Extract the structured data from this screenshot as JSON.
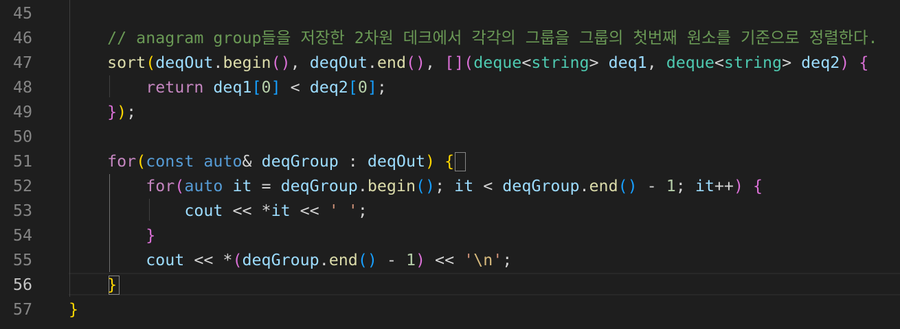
{
  "editor": {
    "current_line": "56",
    "lines": [
      {
        "number": "45",
        "tokens": []
      },
      {
        "number": "46",
        "tokens": [
          {
            "t": "    // anagram group들을 저장한 2차원 데크에서 각각의 그룹을 그룹의 첫번째 원소를 기준으로 정렬한다.",
            "c": "cm"
          }
        ]
      },
      {
        "number": "47",
        "tokens": [
          {
            "t": "    ",
            "c": "pn"
          },
          {
            "t": "sort",
            "c": "fn"
          },
          {
            "t": "(",
            "c": "br1"
          },
          {
            "t": "deqOut",
            "c": "var"
          },
          {
            "t": ".",
            "c": "pn"
          },
          {
            "t": "begin",
            "c": "fn"
          },
          {
            "t": "()",
            "c": "br2"
          },
          {
            "t": ", ",
            "c": "pn"
          },
          {
            "t": "deqOut",
            "c": "var"
          },
          {
            "t": ".",
            "c": "pn"
          },
          {
            "t": "end",
            "c": "fn"
          },
          {
            "t": "()",
            "c": "br2"
          },
          {
            "t": ", ",
            "c": "pn"
          },
          {
            "t": "[]",
            "c": "br2"
          },
          {
            "t": "(",
            "c": "br2"
          },
          {
            "t": "deque",
            "c": "ty"
          },
          {
            "t": "<",
            "c": "pn"
          },
          {
            "t": "string",
            "c": "ty"
          },
          {
            "t": "> ",
            "c": "pn"
          },
          {
            "t": "deq1",
            "c": "var"
          },
          {
            "t": ", ",
            "c": "pn"
          },
          {
            "t": "deque",
            "c": "ty"
          },
          {
            "t": "<",
            "c": "pn"
          },
          {
            "t": "string",
            "c": "ty"
          },
          {
            "t": "> ",
            "c": "pn"
          },
          {
            "t": "deq2",
            "c": "var"
          },
          {
            "t": ")",
            "c": "br2"
          },
          {
            "t": " ",
            "c": "pn"
          },
          {
            "t": "{",
            "c": "br2"
          }
        ]
      },
      {
        "number": "48",
        "tokens": [
          {
            "t": "        ",
            "c": "pn"
          },
          {
            "t": "return",
            "c": "ctl"
          },
          {
            "t": " ",
            "c": "pn"
          },
          {
            "t": "deq1",
            "c": "var"
          },
          {
            "t": "[",
            "c": "br3"
          },
          {
            "t": "0",
            "c": "num"
          },
          {
            "t": "]",
            "c": "br3"
          },
          {
            "t": " < ",
            "c": "pn"
          },
          {
            "t": "deq2",
            "c": "var"
          },
          {
            "t": "[",
            "c": "br3"
          },
          {
            "t": "0",
            "c": "num"
          },
          {
            "t": "]",
            "c": "br3"
          },
          {
            "t": ";",
            "c": "pn"
          }
        ]
      },
      {
        "number": "49",
        "tokens": [
          {
            "t": "    ",
            "c": "pn"
          },
          {
            "t": "}",
            "c": "br2"
          },
          {
            "t": ")",
            "c": "br1"
          },
          {
            "t": ";",
            "c": "pn"
          }
        ]
      },
      {
        "number": "50",
        "tokens": []
      },
      {
        "number": "51",
        "tokens": [
          {
            "t": "    ",
            "c": "pn"
          },
          {
            "t": "for",
            "c": "ctl"
          },
          {
            "t": "(",
            "c": "br1"
          },
          {
            "t": "const",
            "c": "kw"
          },
          {
            "t": " ",
            "c": "pn"
          },
          {
            "t": "auto",
            "c": "kw"
          },
          {
            "t": "& ",
            "c": "pn"
          },
          {
            "t": "deqGroup",
            "c": "var"
          },
          {
            "t": " : ",
            "c": "pn"
          },
          {
            "t": "deqOut",
            "c": "var"
          },
          {
            "t": ")",
            "c": "br1"
          },
          {
            "t": " ",
            "c": "pn"
          },
          {
            "t": "{",
            "c": "br1"
          }
        ]
      },
      {
        "number": "52",
        "tokens": [
          {
            "t": "        ",
            "c": "pn"
          },
          {
            "t": "for",
            "c": "ctl"
          },
          {
            "t": "(",
            "c": "br2"
          },
          {
            "t": "auto",
            "c": "kw"
          },
          {
            "t": " ",
            "c": "pn"
          },
          {
            "t": "it",
            "c": "var"
          },
          {
            "t": " = ",
            "c": "pn"
          },
          {
            "t": "deqGroup",
            "c": "var"
          },
          {
            "t": ".",
            "c": "pn"
          },
          {
            "t": "begin",
            "c": "fn"
          },
          {
            "t": "()",
            "c": "br3"
          },
          {
            "t": "; ",
            "c": "pn"
          },
          {
            "t": "it",
            "c": "var"
          },
          {
            "t": " < ",
            "c": "pn"
          },
          {
            "t": "deqGroup",
            "c": "var"
          },
          {
            "t": ".",
            "c": "pn"
          },
          {
            "t": "end",
            "c": "fn"
          },
          {
            "t": "()",
            "c": "br3"
          },
          {
            "t": " - ",
            "c": "pn"
          },
          {
            "t": "1",
            "c": "num"
          },
          {
            "t": "; ",
            "c": "pn"
          },
          {
            "t": "it",
            "c": "var"
          },
          {
            "t": "++",
            "c": "pn"
          },
          {
            "t": ")",
            "c": "br2"
          },
          {
            "t": " ",
            "c": "pn"
          },
          {
            "t": "{",
            "c": "br2"
          }
        ]
      },
      {
        "number": "53",
        "tokens": [
          {
            "t": "            ",
            "c": "pn"
          },
          {
            "t": "cout",
            "c": "var"
          },
          {
            "t": " << *",
            "c": "pn"
          },
          {
            "t": "it",
            "c": "var"
          },
          {
            "t": " << ",
            "c": "pn"
          },
          {
            "t": "' '",
            "c": "str"
          },
          {
            "t": ";",
            "c": "pn"
          }
        ]
      },
      {
        "number": "54",
        "tokens": [
          {
            "t": "        ",
            "c": "pn"
          },
          {
            "t": "}",
            "c": "br2"
          }
        ]
      },
      {
        "number": "55",
        "tokens": [
          {
            "t": "        ",
            "c": "pn"
          },
          {
            "t": "cout",
            "c": "var"
          },
          {
            "t": " << *",
            "c": "pn"
          },
          {
            "t": "(",
            "c": "br2"
          },
          {
            "t": "deqGroup",
            "c": "var"
          },
          {
            "t": ".",
            "c": "pn"
          },
          {
            "t": "end",
            "c": "fn"
          },
          {
            "t": "()",
            "c": "br3"
          },
          {
            "t": " - ",
            "c": "pn"
          },
          {
            "t": "1",
            "c": "num"
          },
          {
            "t": ")",
            "c": "br2"
          },
          {
            "t": " << ",
            "c": "pn"
          },
          {
            "t": "'",
            "c": "str"
          },
          {
            "t": "\\n",
            "c": "esc"
          },
          {
            "t": "'",
            "c": "str"
          },
          {
            "t": ";",
            "c": "pn"
          }
        ]
      },
      {
        "number": "56",
        "tokens": [
          {
            "t": "    ",
            "c": "pn"
          },
          {
            "t": "}",
            "c": "br1"
          }
        ]
      },
      {
        "number": "57",
        "tokens": [
          {
            "t": "}",
            "c": "br1"
          }
        ]
      }
    ]
  }
}
